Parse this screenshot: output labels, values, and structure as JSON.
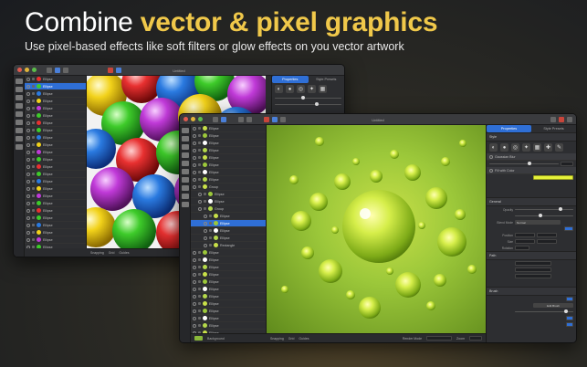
{
  "hero": {
    "title_part1": "Combine ",
    "title_highlight": "vector & pixel graphics",
    "subtitle": "Use pixel-based effects like soft filters or glow effects on you vector artwork"
  },
  "back_window": {
    "title": "Untitled",
    "layers": [
      "Ellipse",
      "Ellipse",
      "Ellipse",
      "Ellipse",
      "Ellipse",
      "Ellipse",
      "Ellipse",
      "Ellipse",
      "Ellipse",
      "Ellipse",
      "Ellipse",
      "Ellipse",
      "Ellipse",
      "Ellipse",
      "Ellipse",
      "Ellipse",
      "Ellipse",
      "Ellipse",
      "Ellipse",
      "Ellipse",
      "Ellipse",
      "Ellipse",
      "Ellipse",
      "Ellipse"
    ],
    "inspector_tabs": [
      "Properties",
      "Style Presets"
    ],
    "status": [
      "Snapping",
      "Grid",
      "Guides"
    ]
  },
  "front_window": {
    "title": "Untitled",
    "layers": [
      "Ellipse",
      "Ellipse",
      "Ellipse",
      "Ellipse",
      "Ellipse",
      "Ellipse",
      "Ellipse",
      "Ellipse",
      "Group",
      "Ellipse",
      "Ellipse",
      "Group",
      "Ellipse",
      "Ellipse",
      "Ellipse",
      "Ellipse",
      "Rectangle",
      "Ellipse",
      "Ellipse",
      "Ellipse",
      "Ellipse",
      "Ellipse",
      "Ellipse",
      "Ellipse",
      "Ellipse",
      "Ellipse",
      "Ellipse",
      "Ellipse",
      "Ellipse",
      "Ellipse"
    ],
    "selected_layer": "Ellipse",
    "background_layer": "Background",
    "inspector_tabs": [
      "Properties",
      "Style Presets"
    ],
    "style_section": "Style",
    "effects": [
      "Gaussian Blur",
      "Fill with Color"
    ],
    "general_section": "General",
    "general_props": [
      {
        "label": "Opacity",
        "value": ""
      },
      {
        "label": "Position",
        "value": ""
      },
      {
        "label": "Blend Mode",
        "value": "Normal"
      },
      {
        "label": "Position",
        "value": ""
      },
      {
        "label": "Size",
        "value": ""
      },
      {
        "label": "Rotation",
        "value": ""
      }
    ],
    "path_section": "Path",
    "brush_section": "Brush",
    "brush_button": "Edit Brush",
    "status": [
      "Snapping",
      "Grid",
      "Guides"
    ],
    "render_mode_label": "Render Mode",
    "zoom_label": "Zoom"
  },
  "colors": {
    "accent": "#2f6fd6",
    "title_highlight": "#f0c84a",
    "canvas_green": "#9cc83a"
  }
}
